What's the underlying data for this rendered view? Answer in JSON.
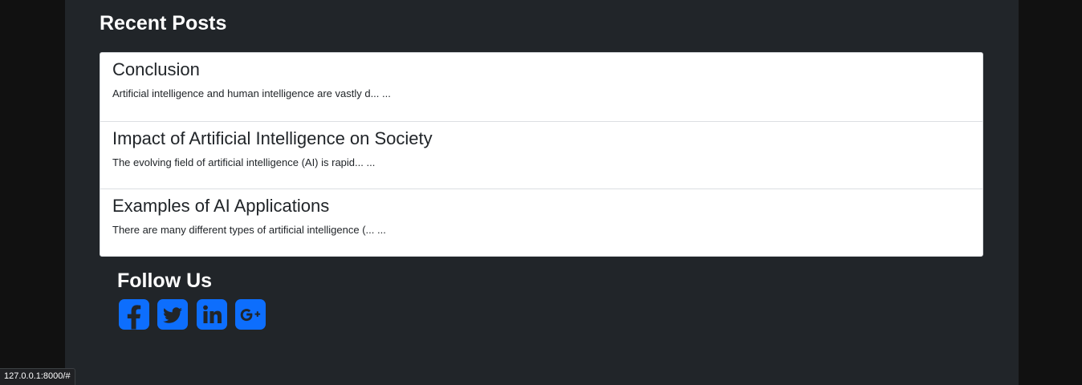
{
  "recent_posts": {
    "heading": "Recent Posts",
    "posts": [
      {
        "title": "Conclusion",
        "excerpt": "Artificial intelligence and human intelligence are vastly d... ..."
      },
      {
        "title": "Impact of Artificial Intelligence on Society",
        "excerpt": "The evolving field of artificial intelligence (AI) is rapid... ..."
      },
      {
        "title": "Examples of AI Applications",
        "excerpt": "There are many different types of artificial intelligence (... ..."
      }
    ]
  },
  "follow_us": {
    "heading": "Follow Us",
    "icons": [
      "facebook-icon",
      "twitter-icon",
      "linkedin-icon",
      "google-plus-icon"
    ],
    "icon_color": "#0d6efd"
  },
  "status_bar": {
    "url": "127.0.0.1:8000/#"
  },
  "colors": {
    "page_background": "#111111",
    "panel_background": "#212529",
    "card_background": "#ffffff",
    "text_dark": "#212529",
    "text_light": "#ffffff"
  }
}
